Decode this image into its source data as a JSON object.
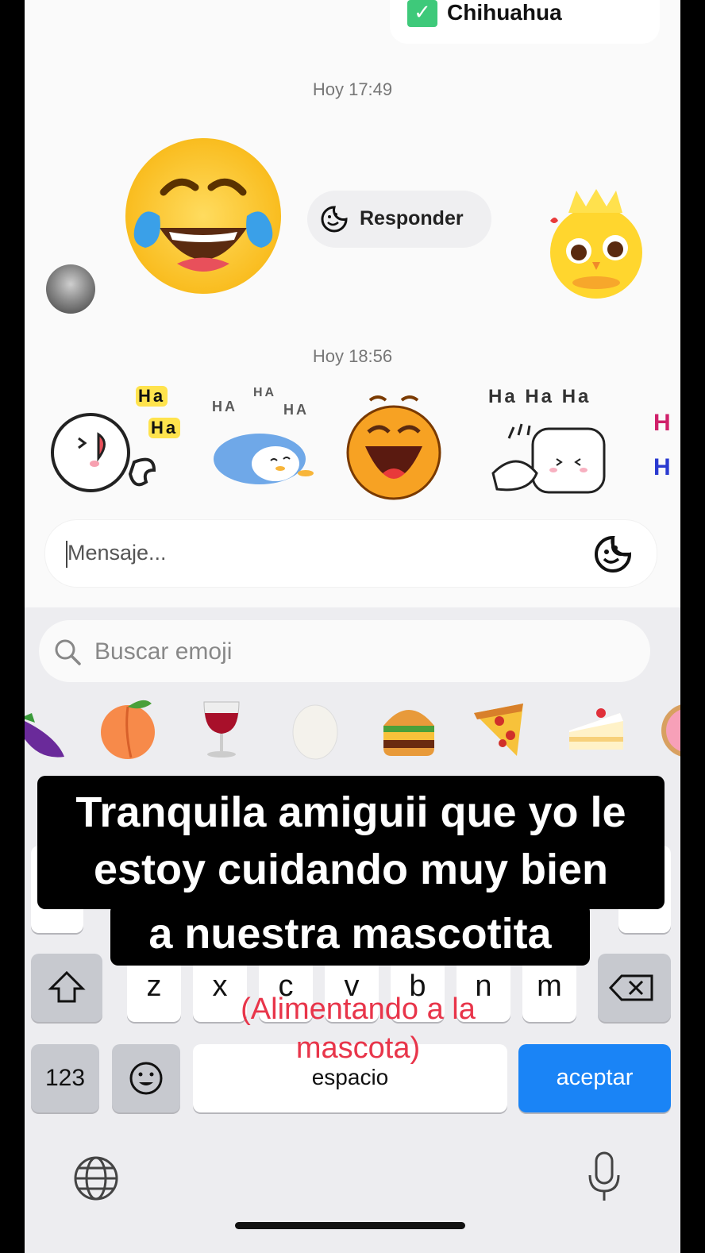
{
  "chat": {
    "previous_message": "Chihuahua",
    "timestamp_1": "Hoy 17:49",
    "reply_label": "Responder",
    "timestamp_2": "Hoy 18:56",
    "stickers": [
      {
        "name": "ha-ha-bunny-sticker",
        "text_1": "Ha",
        "text_2": "Ha"
      },
      {
        "name": "ha-ha-penguin-sticker",
        "text_1": "HA",
        "text_2": "HA",
        "text_3": "HA"
      },
      {
        "name": "laughing-face-sticker"
      },
      {
        "name": "ha-ha-ha-cat-sticker",
        "text_1": "Ha Ha Ha"
      },
      {
        "name": "partial-sticker",
        "text_1": "H",
        "text_2": "H"
      }
    ]
  },
  "composer": {
    "placeholder": "Mensaje..."
  },
  "keyboard": {
    "search_placeholder": "Buscar emoji",
    "emoji_strip": [
      "eggplant",
      "peach",
      "wine-glass",
      "egg",
      "hamburger",
      "pizza",
      "cake",
      "doughnut"
    ],
    "row_letters": [
      "z",
      "x",
      "c",
      "v",
      "b",
      "n",
      "m"
    ],
    "numbers_key": "123",
    "space_key": "espacio",
    "accept_key": "aceptar"
  },
  "overlay": {
    "caption_lines": [
      "Tranquila amiguii que yo le",
      "estoy cuidando muy bien",
      "a nuestra mascotita"
    ],
    "subcaption_lines": [
      "(Alimentando a la",
      "mascota)"
    ]
  },
  "colors": {
    "accent_blue": "#1a84f6",
    "subcaption_red": "#e8354a",
    "check_green": "#3ec97a"
  }
}
